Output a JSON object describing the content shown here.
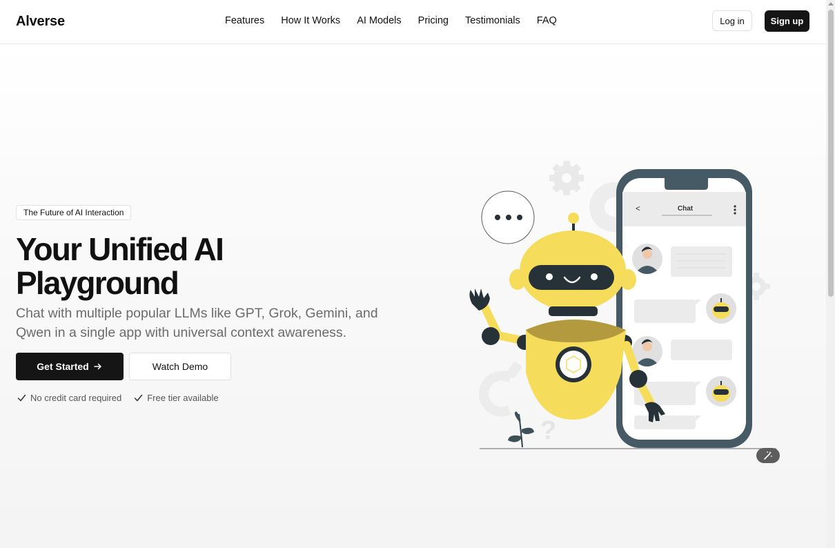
{
  "header": {
    "logo": "Alverse",
    "nav": [
      "Features",
      "How It Works",
      "AI Models",
      "Pricing",
      "Testimonials",
      "FAQ"
    ],
    "login_label": "Log in",
    "signup_label": "Sign up"
  },
  "hero": {
    "badge": "The Future of AI Interaction",
    "title": "Your Unified AI Playground",
    "subtitle": "Chat with multiple popular LLMs like GPT, Grok, Gemini, and Qwen in a single app with universal context awareness.",
    "cta_primary": "Get Started",
    "cta_secondary": "Watch Demo",
    "perks": [
      "No credit card required",
      "Free tier available"
    ]
  },
  "illustration": {
    "chat_header": "Chat",
    "back_symbol": "<"
  },
  "colors": {
    "accent_yellow": "#f5dc5a",
    "dark_slate": "#455a64",
    "primary_button": "#151515"
  },
  "icons": [
    "arrow-right-icon",
    "check-icon",
    "magic-wand-icon",
    "gear-icon",
    "chevron-left-icon",
    "more-vertical-icon"
  ]
}
